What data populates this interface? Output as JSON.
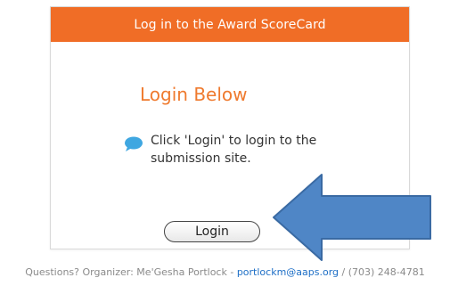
{
  "panel": {
    "header_title": "Log in to the Award ScoreCard",
    "heading": "Login Below",
    "instruction_icon": "speech-bubble-icon",
    "instruction_text": "Click 'Login' to login to the submission site.",
    "login_label": "Login"
  },
  "annotation": {
    "arrow_icon": "left-arrow-icon"
  },
  "footer": {
    "prefix": "Questions? Organizer: Me'Gesha Portlock - ",
    "email": "portlockm@aaps.org",
    "suffix": " / (703) 248-4781"
  },
  "colors": {
    "header_bg": "#f06d26",
    "heading": "#ef7a2e",
    "arrow_fill": "#4f86c6",
    "arrow_stroke": "#3a6aa3",
    "link": "#1e6fc6",
    "chat_icon": "#3fa7e1"
  }
}
